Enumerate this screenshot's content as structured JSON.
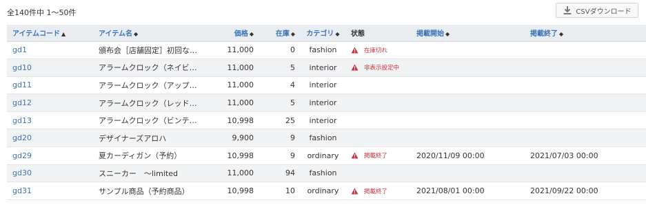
{
  "summary": "全140件中 1〜50件",
  "csv_button": "CSVダウンロード",
  "columns": {
    "code": "アイテムコード",
    "name": "アイテム名",
    "price": "価格",
    "stock": "在庫",
    "category": "カテゴリ",
    "status": "状態",
    "start": "掲載開始",
    "end": "掲載終了"
  },
  "sort_icons": {
    "asc": "▲",
    "both": "◆"
  },
  "rows": [
    {
      "code": "gd1",
      "name": "頒布会［店舗固定］初回なし…",
      "price": "11,000",
      "stock": "0",
      "category": "fashion",
      "status": "在庫切れ",
      "start": "",
      "end": ""
    },
    {
      "code": "gd10",
      "name": "アラームクロック（ネイビー…",
      "price": "11,000",
      "stock": "5",
      "category": "interior",
      "status": "非表示設定中",
      "start": "",
      "end": ""
    },
    {
      "code": "gd11",
      "name": "アラームクロック（アップル…",
      "price": "11,000",
      "stock": "4",
      "category": "interior",
      "status": "",
      "start": "",
      "end": ""
    },
    {
      "code": "gd12",
      "name": "アラームクロック（レッド・…",
      "price": "11,000",
      "stock": "5",
      "category": "interior",
      "status": "",
      "start": "",
      "end": ""
    },
    {
      "code": "gd13",
      "name": "アラームクロック（ビンテー…",
      "price": "10,998",
      "stock": "25",
      "category": "interior",
      "status": "",
      "start": "",
      "end": ""
    },
    {
      "code": "gd20",
      "name": "デザイナーズアロハ",
      "price": "9,900",
      "stock": "9",
      "category": "fashion",
      "status": "",
      "start": "",
      "end": ""
    },
    {
      "code": "gd29",
      "name": "夏カーディガン（予約）",
      "price": "10,998",
      "stock": "9",
      "category": "ordinary",
      "status": "掲載終了",
      "start": "2020/11/09 00:00",
      "end": "2021/07/03 00:00"
    },
    {
      "code": "gd30",
      "name": "スニーカー　～limited",
      "price": "11,000",
      "stock": "94",
      "category": "fashion",
      "status": "",
      "start": "",
      "end": ""
    },
    {
      "code": "gd31",
      "name": "サンプル商品（予約商品）",
      "price": "10,998",
      "stock": "10",
      "category": "ordinary",
      "status": "掲載終了",
      "start": "2021/08/01 00:00",
      "end": "2021/09/22 00:00"
    }
  ]
}
